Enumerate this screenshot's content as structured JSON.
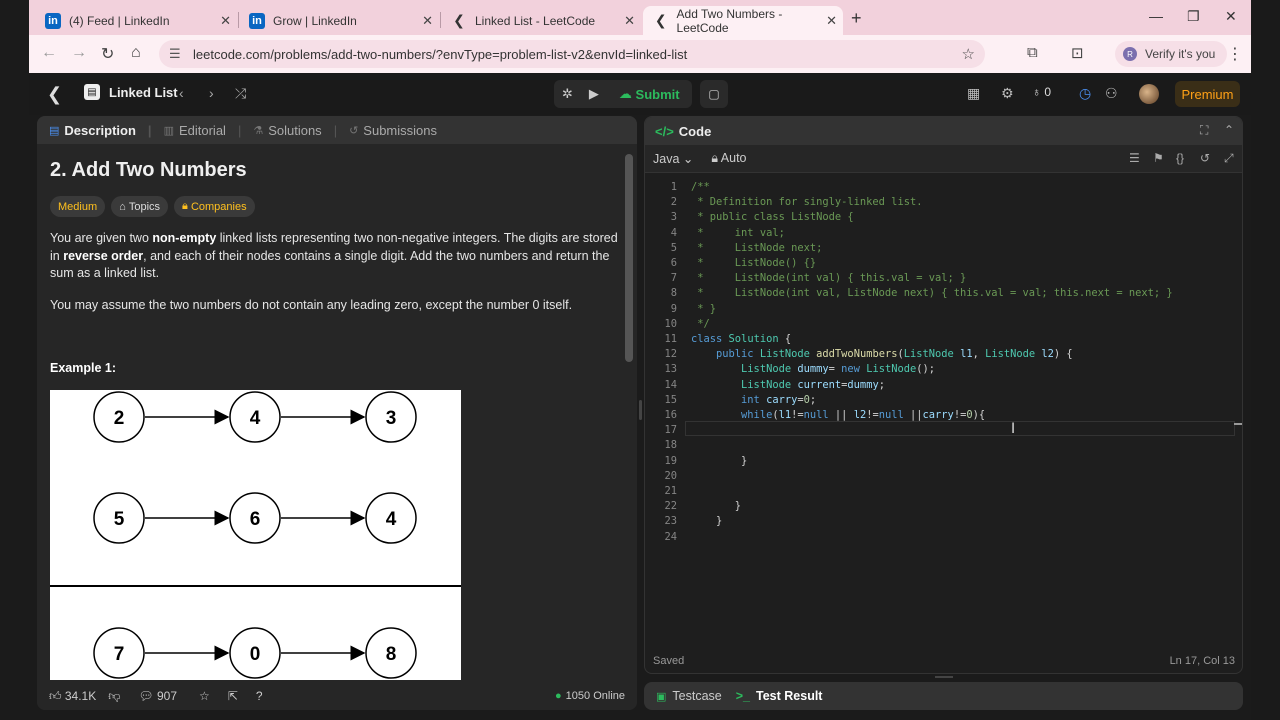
{
  "browser": {
    "tabs": [
      {
        "title": "(4) Feed | LinkedIn",
        "icon": "linkedin-icon"
      },
      {
        "title": "Grow | LinkedIn",
        "icon": "linkedin-icon"
      },
      {
        "title": "Linked List - LeetCode",
        "icon": "leetcode-icon"
      },
      {
        "title": "Add Two Numbers - LeetCode",
        "icon": "leetcode-icon",
        "active": true
      }
    ],
    "url": "leetcode.com/problems/add-two-numbers/?envType=problem-list-v2&envId=linked-list",
    "profile_label": "Verify it's you",
    "profile_initial": "R"
  },
  "lc_nav": {
    "problem_list": "Linked List",
    "submit_label": "Submit",
    "streak_count": "0",
    "premium_label": "Premium",
    "brand_color": "#ffa116",
    "accent_green": "#2cbb5d"
  },
  "left_panel": {
    "tabs": [
      "Description",
      "Editorial",
      "Solutions",
      "Submissions"
    ],
    "title": "2. Add Two Numbers",
    "difficulty": "Medium",
    "chip_topics": "Topics",
    "chip_companies": "Companies",
    "para1_a": "You are given two ",
    "para1_b": "non-empty",
    "para1_c": " linked lists representing two non-negative integers. The digits are stored in ",
    "para1_d": "reverse order",
    "para1_e": ", and each of their nodes contains a single digit. Add the two numbers and return the sum as a linked list.",
    "para2": "You may assume the two numbers do not contain any leading zero, except the number 0 itself.",
    "example_label": "Example 1:",
    "figure_rows": [
      [
        "2",
        "4",
        "3"
      ],
      [
        "5",
        "6",
        "4"
      ],
      [
        "7",
        "0",
        "8"
      ]
    ],
    "likes": "34.1K",
    "comments": "907",
    "online": "1050 Online"
  },
  "right_panel": {
    "header": "Code",
    "language": "Java",
    "mode": "Auto",
    "code_lines": [
      "/**",
      " * Definition for singly-linked list.",
      " * public class ListNode {",
      " *     int val;",
      " *     ListNode next;",
      " *     ListNode() {}",
      " *     ListNode(int val) { this.val = val; }",
      " *     ListNode(int val, ListNode next) { this.val = val; this.next = next; }",
      " * }",
      " */",
      "class Solution {",
      "    public ListNode addTwoNumbers(ListNode l1, ListNode l2) {",
      "        ListNode dummy= new ListNode();",
      "        ListNode current=dummy;",
      "        int carry=0;",
      "        while(l1!=null || l2!=null ||carry!=0){",
      "",
      "",
      "        }",
      "",
      "",
      "       }",
      "    }",
      ""
    ],
    "status": "Saved",
    "cursor_pos": "Ln 17, Col 13",
    "bottom_tabs": [
      "Testcase",
      "Test Result"
    ]
  }
}
